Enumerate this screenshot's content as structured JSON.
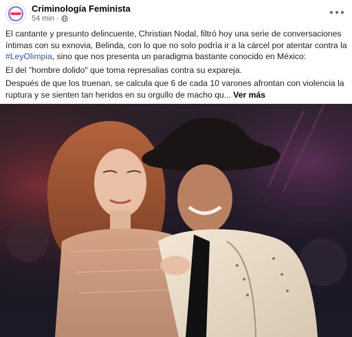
{
  "post": {
    "page_name": "Criminología Feminista",
    "time": "54 min",
    "separator": "·",
    "more_icon": "ellipsis-icon",
    "paragraphs": {
      "p1_part1": "El cantante y presunto delincuente, Christian Nodal, filtró hoy una serie de conversaciones íntimas con su exnovia, Belinda, con lo que no solo podría ir a la cárcel por atentar contra la ",
      "p1_hashtag": "#LeyOlimpia",
      "p1_part2": ", sino que nos presenta un paradigma bastante conocido en México:",
      "p2": "El del \"hombre dolido\" que toma represalias contra su expareja.",
      "p3": "Después de que los truenan, se calcula que 6 de cada 10 varones afrontan con violencia la ruptura y se sienten tan heridos en su orgullo de macho qu... ",
      "see_more": "Ver más"
    }
  },
  "colors": {
    "text": "#1c1e21",
    "meta": "#65676b",
    "hashtag": "#385898"
  }
}
